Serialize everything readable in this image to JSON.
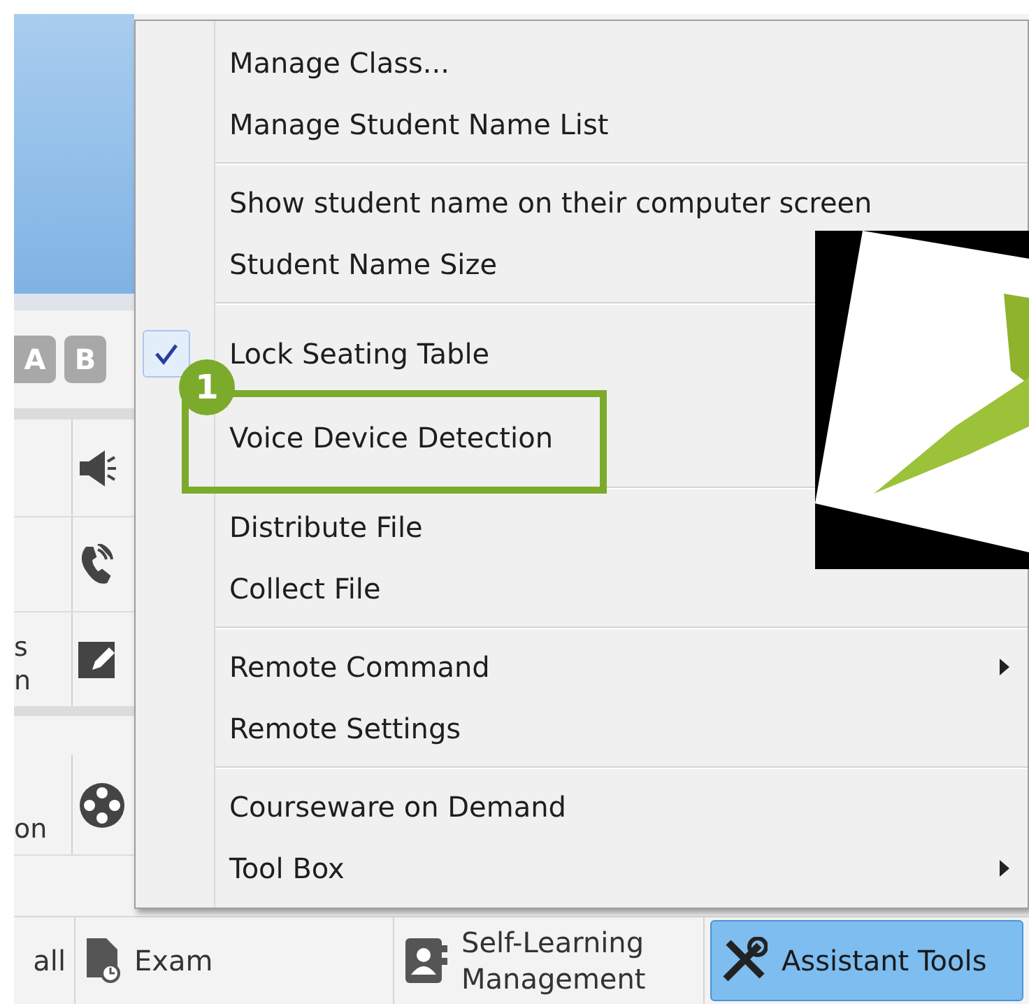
{
  "background_panel": {
    "letter_badges": [
      "A",
      "B"
    ],
    "rows": [
      {
        "label_lines": []
      },
      {
        "label_lines": []
      },
      {
        "label_lines": [
          "s",
          "n"
        ]
      },
      {
        "label_lines": [
          "on"
        ]
      }
    ]
  },
  "menu": {
    "groups": [
      {
        "items": [
          {
            "label": "Manage Class...",
            "checked": false,
            "submenu": false
          },
          {
            "label": "Manage Student Name List",
            "checked": false,
            "submenu": false
          }
        ]
      },
      {
        "items": [
          {
            "label": "Show student name on their computer screen",
            "checked": false,
            "submenu": false
          },
          {
            "label": "Student Name Size",
            "checked": false,
            "submenu": false
          }
        ]
      },
      {
        "items": [
          {
            "label": "Lock Seating Table",
            "checked": true,
            "submenu": false
          },
          {
            "label": "Voice Device Detection",
            "checked": false,
            "submenu": false,
            "callout": "1"
          }
        ]
      },
      {
        "items": [
          {
            "label": "Distribute File",
            "checked": false,
            "submenu": false
          },
          {
            "label": "Collect File",
            "checked": false,
            "submenu": false
          }
        ]
      },
      {
        "items": [
          {
            "label": "Remote Command",
            "checked": false,
            "submenu": true
          },
          {
            "label": "Remote Settings",
            "checked": false,
            "submenu": false
          }
        ]
      },
      {
        "items": [
          {
            "label": "Courseware on Demand",
            "checked": false,
            "submenu": false
          },
          {
            "label": "Tool Box",
            "checked": false,
            "submenu": true
          }
        ]
      }
    ]
  },
  "toolbar": {
    "items": [
      {
        "label": "all",
        "selected": false
      },
      {
        "label": "Exam",
        "selected": false
      },
      {
        "label": "Self-Learning\nManagement",
        "selected": false
      },
      {
        "label": "Assistant Tools",
        "selected": true
      }
    ]
  }
}
